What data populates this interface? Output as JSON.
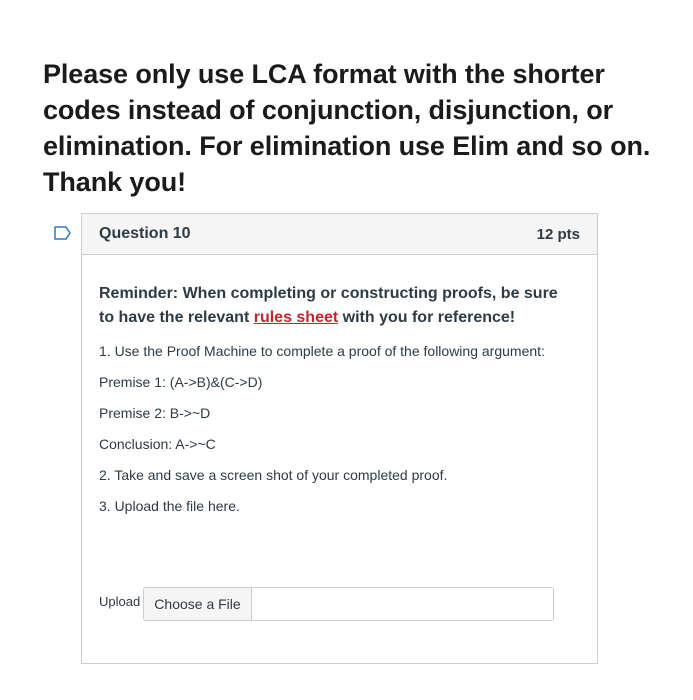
{
  "intro": {
    "text": "Please only use LCA format with the shorter codes instead of conjunction, disjunction, or elimination. For elimination use Elim and so on. Thank you!"
  },
  "question": {
    "title": "Question 10",
    "points": "12 pts",
    "flag_icon": "bookmark-flag-icon",
    "reminder_prefix": "Reminder: When completing or constructing proofs, be sure to have the relevant ",
    "reminder_link": "rules sheet",
    "reminder_suffix": " with you for reference!",
    "link_color": "#c4252c",
    "lines": [
      "1. Use the Proof Machine to complete a proof of the following argument:",
      "Premise 1: (A->B)&(C->D)",
      "Premise 2: B->~D",
      "Conclusion: A->~C",
      "2. Take and save a screen shot of your completed proof.",
      "3. Upload the file here."
    ],
    "upload_label": "Upload",
    "choose_file_label": "Choose a File"
  }
}
